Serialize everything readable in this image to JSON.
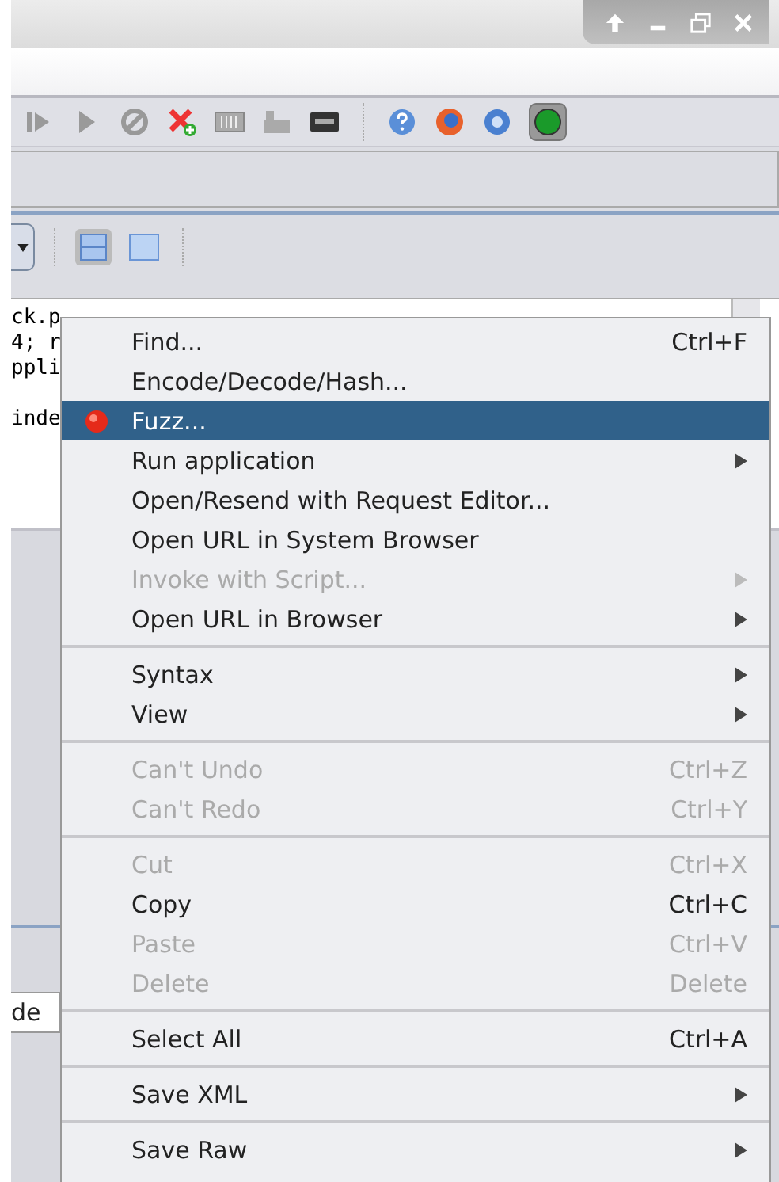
{
  "editor": {
    "lines": [
      "ck.p",
      "4; r",
      "ppli",
      "inde"
    ]
  },
  "bottom_field": {
    "value": "de"
  },
  "context_menu": {
    "groups": [
      [
        {
          "kind": "text",
          "label": "Find...",
          "shortcut": "Ctrl+F",
          "disabled": false,
          "selected": false,
          "submenu": false
        },
        {
          "kind": "text",
          "label": "Encode/Decode/Hash...",
          "disabled": false,
          "selected": false,
          "submenu": false
        },
        {
          "kind": "icon",
          "label": "Fuzz...",
          "disabled": false,
          "selected": true,
          "submenu": false
        },
        {
          "kind": "text",
          "label": "Run application",
          "disabled": false,
          "selected": false,
          "submenu": true
        },
        {
          "kind": "text",
          "label": "Open/Resend with Request Editor...",
          "disabled": false,
          "selected": false,
          "submenu": false
        },
        {
          "kind": "text",
          "label": "Open URL in System Browser",
          "disabled": false,
          "selected": false,
          "submenu": false
        },
        {
          "kind": "text",
          "label": "Invoke with Script...",
          "disabled": true,
          "selected": false,
          "submenu": true
        },
        {
          "kind": "text",
          "label": "Open URL in Browser",
          "disabled": false,
          "selected": false,
          "submenu": true
        }
      ],
      [
        {
          "kind": "text",
          "label": "Syntax",
          "disabled": false,
          "selected": false,
          "submenu": true
        },
        {
          "kind": "text",
          "label": "View",
          "disabled": false,
          "selected": false,
          "submenu": true
        }
      ],
      [
        {
          "kind": "text",
          "label": "Can't Undo",
          "shortcut": "Ctrl+Z",
          "disabled": true,
          "selected": false,
          "submenu": false
        },
        {
          "kind": "text",
          "label": "Can't Redo",
          "shortcut": "Ctrl+Y",
          "disabled": true,
          "selected": false,
          "submenu": false
        }
      ],
      [
        {
          "kind": "text",
          "label": "Cut",
          "shortcut": "Ctrl+X",
          "disabled": true,
          "selected": false,
          "submenu": false
        },
        {
          "kind": "text",
          "label": "Copy",
          "shortcut": "Ctrl+C",
          "disabled": false,
          "selected": false,
          "submenu": false
        },
        {
          "kind": "text",
          "label": "Paste",
          "shortcut": "Ctrl+V",
          "disabled": true,
          "selected": false,
          "submenu": false
        },
        {
          "kind": "text",
          "label": "Delete",
          "shortcut": "Delete",
          "disabled": true,
          "selected": false,
          "submenu": false
        }
      ],
      [
        {
          "kind": "text",
          "label": "Select All",
          "shortcut": "Ctrl+A",
          "disabled": false,
          "selected": false,
          "submenu": false
        }
      ],
      [
        {
          "kind": "text",
          "label": "Save XML",
          "disabled": false,
          "selected": false,
          "submenu": true
        }
      ],
      [
        {
          "kind": "text",
          "label": "Save Raw",
          "disabled": false,
          "selected": false,
          "submenu": true
        }
      ]
    ]
  }
}
